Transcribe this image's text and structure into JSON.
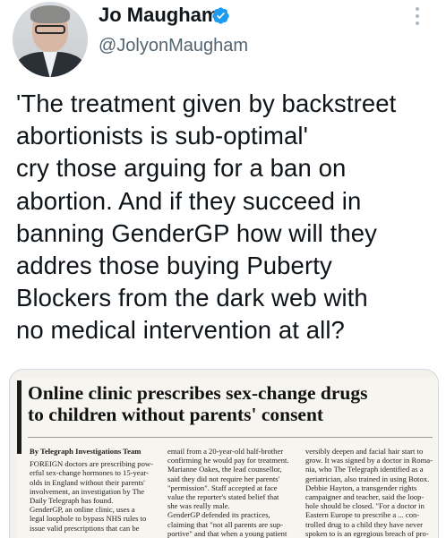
{
  "author": {
    "name": "Jo Maugham",
    "handle": "@JolyonMaugham",
    "verified_icon": "verified-badge-icon",
    "avatar_icon": "profile-photo"
  },
  "tweet": {
    "lines": [
      "'The treatment given by backstreet",
      "abortionists is sub-optimal'",
      "cry those arguing for a ban on",
      "abortion. And if they succeed in",
      "banning GenderGP how will they",
      "addres those buying Puberty",
      "Blockers from the dark web with",
      "no medical intervention at all?"
    ]
  },
  "clipping": {
    "headline": [
      "Online clinic prescribes sex-change drugs",
      "to children without parents' consent"
    ],
    "col1": [
      "By Telegraph Investigations Team",
      "",
      "FOREIGN doctors are prescribing pow-",
      "erful sex-change hormones to 15-year-",
      "olds in England without their parents'",
      "involvement, an investigation by The",
      "Daily Telegraph has found.",
      "GenderGP, an online clinic, uses a",
      "legal loophole to bypass NHS rules to",
      "issue valid prescriptions that can be"
    ],
    "col2": [
      "email from a 20-year-old half-brother",
      "confirming he would pay for treatment.",
      "Marianne Oakes, the lead counsellor,",
      "said they did not require her parents'",
      "\"permission\". Staff accepted at face",
      "value the reporter's stated belief that",
      "she was really male.",
      "GenderGP defended its practices,",
      "claiming that \"not all parents are sup-",
      "portive\" and that when a young patient"
    ],
    "col3": [
      "versibly deepen and facial hair start to",
      "grow. It was signed by a doctor in Roma-",
      "nia, who The Telegraph identified as a",
      "geriatrician, also trained in using Botox.",
      "Debbie Hayton, a transgender rights",
      "campaigner and teacher, said the loop-",
      "hole should be closed. \"For a doctor in",
      "Eastern Europe to prescribe a ... con-",
      "trolled drug to a child they have never",
      "spoken to is an egregious breach of pro-"
    ]
  },
  "colors": {
    "text": "#0f1419",
    "secondary": "#536471",
    "verified": "#1d9bf0"
  },
  "icons": {
    "more": "more-options-icon"
  }
}
